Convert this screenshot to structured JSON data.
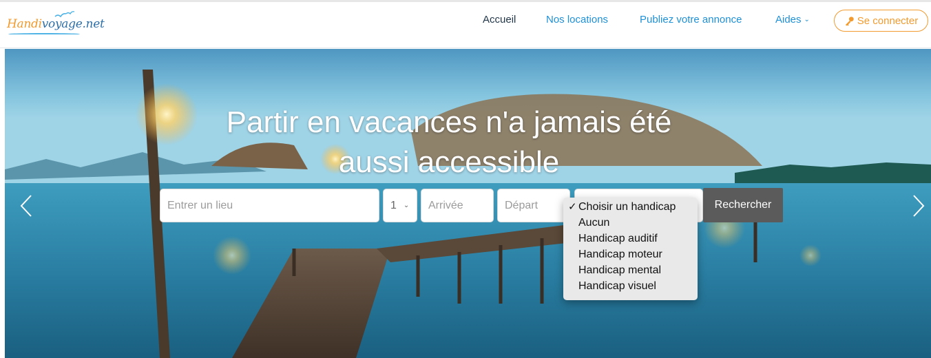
{
  "logo": {
    "part1": "Handi",
    "part2": "voyage.net"
  },
  "nav": {
    "items": [
      {
        "label": "Accueil"
      },
      {
        "label": "Nos locations"
      },
      {
        "label": "Publiez votre annonce"
      },
      {
        "label": "Aides"
      }
    ],
    "login_label": "Se connecter"
  },
  "hero": {
    "title_line1": "Partir en vacances n'a jamais été",
    "title_line2": "aussi accessible"
  },
  "search": {
    "place_placeholder": "Entrer un lieu",
    "guests_value": "1",
    "arrival_placeholder": "Arrivée",
    "departure_placeholder": "Départ",
    "button_label": "Rechercher"
  },
  "handicap_dropdown": {
    "selected_mark": "✓",
    "options": [
      {
        "label": "Choisir un handicap"
      },
      {
        "label": "Aucun"
      },
      {
        "label": "Handicap auditif"
      },
      {
        "label": "Handicap moteur"
      },
      {
        "label": "Handicap mental"
      },
      {
        "label": "Handicap visuel"
      }
    ]
  },
  "colors": {
    "brand_orange": "#f29a2e",
    "brand_blue": "#1e90d6",
    "active_nav": "#1f3446",
    "search_button": "#5b5b5b"
  },
  "icons": {
    "login": "key-icon",
    "prev": "chevron-left-icon",
    "next": "chevron-right-icon"
  }
}
